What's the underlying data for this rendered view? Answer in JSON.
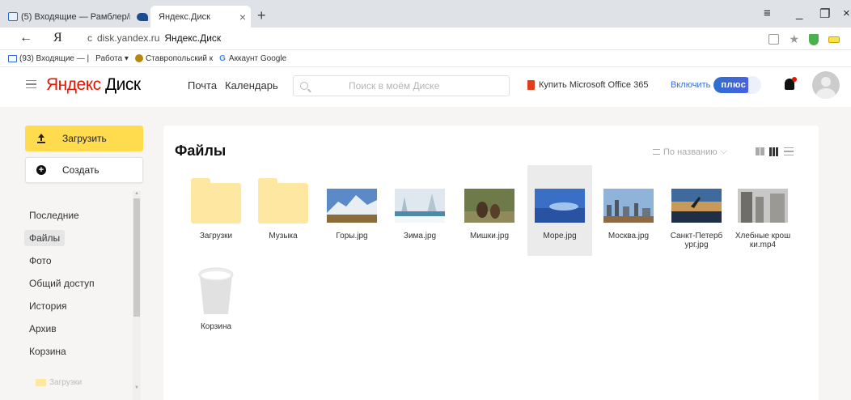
{
  "browser": {
    "tabs": [
      {
        "label": "(5) Входящие — Рамблер/п"
      },
      {
        "label": "Яндекс.Диск",
        "close": "×"
      }
    ],
    "new_tab": "+",
    "window_controls": {
      "menu": "≡",
      "minimize": "_",
      "restore": "❐",
      "close": "×"
    },
    "back": "←",
    "ya": "Я",
    "address_domain": "disk.yandex.ru",
    "address_title": "Яндекс.Диск",
    "bookmarks": [
      {
        "label": "(93) Входящие — |",
        "icon": "mail-icon"
      },
      {
        "label": "Работа ▾",
        "icon": ""
      },
      {
        "label": "Ставропольский к",
        "icon": "site-icon"
      },
      {
        "label": "Аккаунт Google",
        "icon": "google-icon"
      }
    ],
    "bookmark_g": "G"
  },
  "header": {
    "logo_red": "Яндекс",
    "logo_black": " Диск",
    "nav": [
      "Почта",
      "Календарь"
    ],
    "search_placeholder": "Поиск в моём Диске",
    "office_text": "Купить Microsoft Office 365",
    "plus_prefix": "Включить",
    "plus_badge": "плюс"
  },
  "sidebar": {
    "upload_label": "Загрузить",
    "create_label": "Создать",
    "create_icon_glyph": "+",
    "items": [
      {
        "label": "Последние"
      },
      {
        "label": "Файлы",
        "active": true
      },
      {
        "label": "Фото"
      },
      {
        "label": "Общий доступ"
      },
      {
        "label": "История"
      },
      {
        "label": "Архив"
      },
      {
        "label": "Корзина"
      }
    ],
    "folder_tree_item": "Загрузки"
  },
  "main": {
    "title": "Файлы",
    "sort_label": "По названию",
    "sort_chevron": "⌵",
    "files": [
      {
        "name": "Загрузки",
        "kind": "folder"
      },
      {
        "name": "Музыка",
        "kind": "folder"
      },
      {
        "name": "Горы.jpg",
        "kind": "image"
      },
      {
        "name": "Зима.jpg",
        "kind": "image"
      },
      {
        "name": "Мишки.jpg",
        "kind": "image"
      },
      {
        "name": "Море.jpg",
        "kind": "image",
        "selected": true
      },
      {
        "name": "Москва.jpg",
        "kind": "image"
      },
      {
        "name": "Санкт-Петерб",
        "name2": "ург.jpg",
        "kind": "image"
      },
      {
        "name": "Хлебные крош",
        "name2": "ки.mp4",
        "kind": "video"
      },
      {
        "name": "Корзина",
        "kind": "trash"
      }
    ]
  },
  "colors": {
    "yandex_red": "#e61400",
    "upload_yellow": "#ffdb4d",
    "folder_yellow": "#fde7a1",
    "plus_blue": "#2d6fd1"
  }
}
